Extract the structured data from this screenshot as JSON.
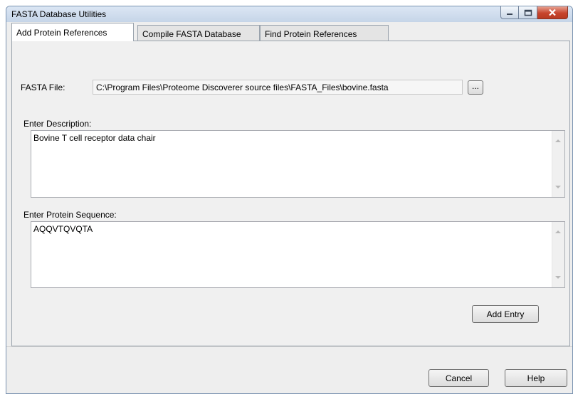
{
  "window": {
    "title": "FASTA Database Utilities"
  },
  "tabs": [
    {
      "label": "Add Protein References",
      "active": true
    },
    {
      "label": "Compile FASTA Database",
      "active": false
    },
    {
      "label": "Find Protein References",
      "active": false
    }
  ],
  "add_protein_references": {
    "fasta_file_label": "FASTA File:",
    "fasta_file_value": "C:\\Program Files\\Proteome Discoverer source files\\FASTA_Files\\bovine.fasta",
    "browse_label": "...",
    "description_label": "Enter Description:",
    "description_value": "Bovine T cell receptor data chair",
    "sequence_label": "Enter Protein Sequence:",
    "sequence_value": "AQQVTQVQTA",
    "add_entry_label": "Add Entry"
  },
  "footer": {
    "cancel_label": "Cancel",
    "help_label": "Help"
  }
}
